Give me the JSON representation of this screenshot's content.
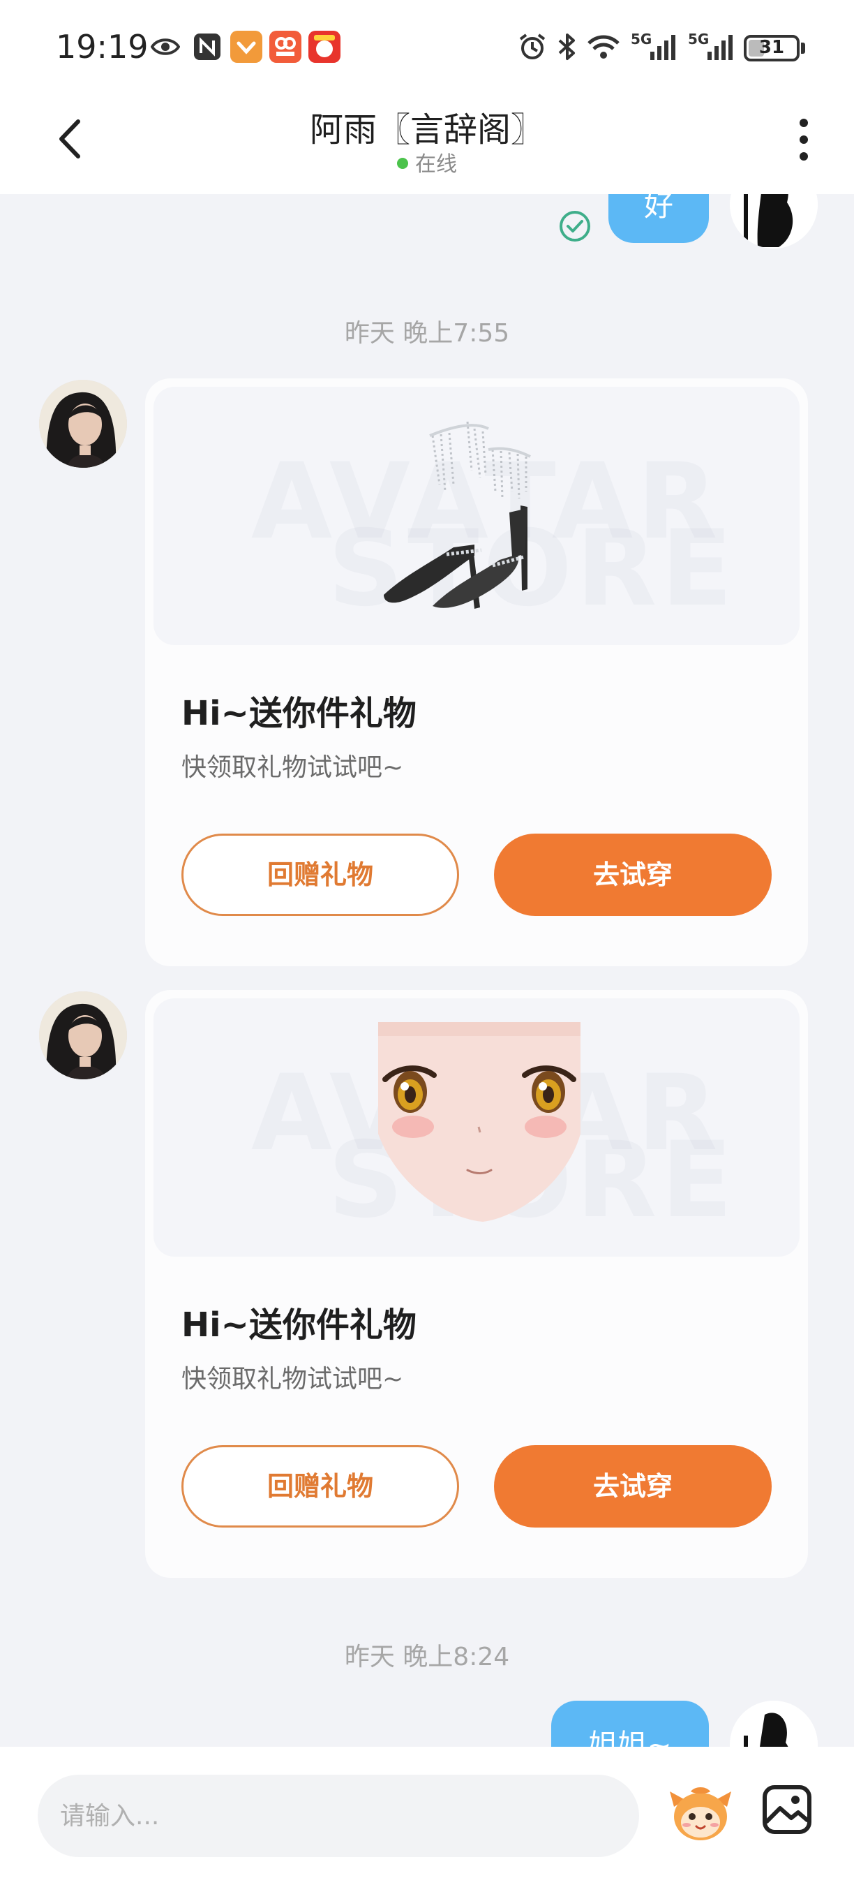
{
  "status_bar": {
    "time": "19:19",
    "battery": "31",
    "signal_1": "5G",
    "signal_2": "5G"
  },
  "header": {
    "title": "阿雨〖言辞阁〗",
    "status": "在线"
  },
  "messages": {
    "first_reply": "好",
    "timestamp_1": "昨天 晚上7:55",
    "timestamp_2": "昨天 晚上8:24",
    "last_reply": "姐姐~"
  },
  "gift_cards": [
    {
      "item": "heels-icon",
      "title": "Hi~送你件礼物",
      "subtitle": "快领取礼物试试吧~",
      "return_label": "回赠礼物",
      "try_label": "去试穿"
    },
    {
      "item": "anime-face-icon",
      "title": "Hi~送你件礼物",
      "subtitle": "快领取礼物试试吧~",
      "return_label": "回赠礼物",
      "try_label": "去试穿"
    }
  ],
  "watermark": {
    "line1": "AVATAR",
    "line2": "STORE"
  },
  "input": {
    "placeholder": "请输入..."
  },
  "colors": {
    "accent": "#f07a32",
    "outgoing_bubble": "#5cb8f5",
    "online": "#4cc34c",
    "background": "#f2f3f7"
  }
}
